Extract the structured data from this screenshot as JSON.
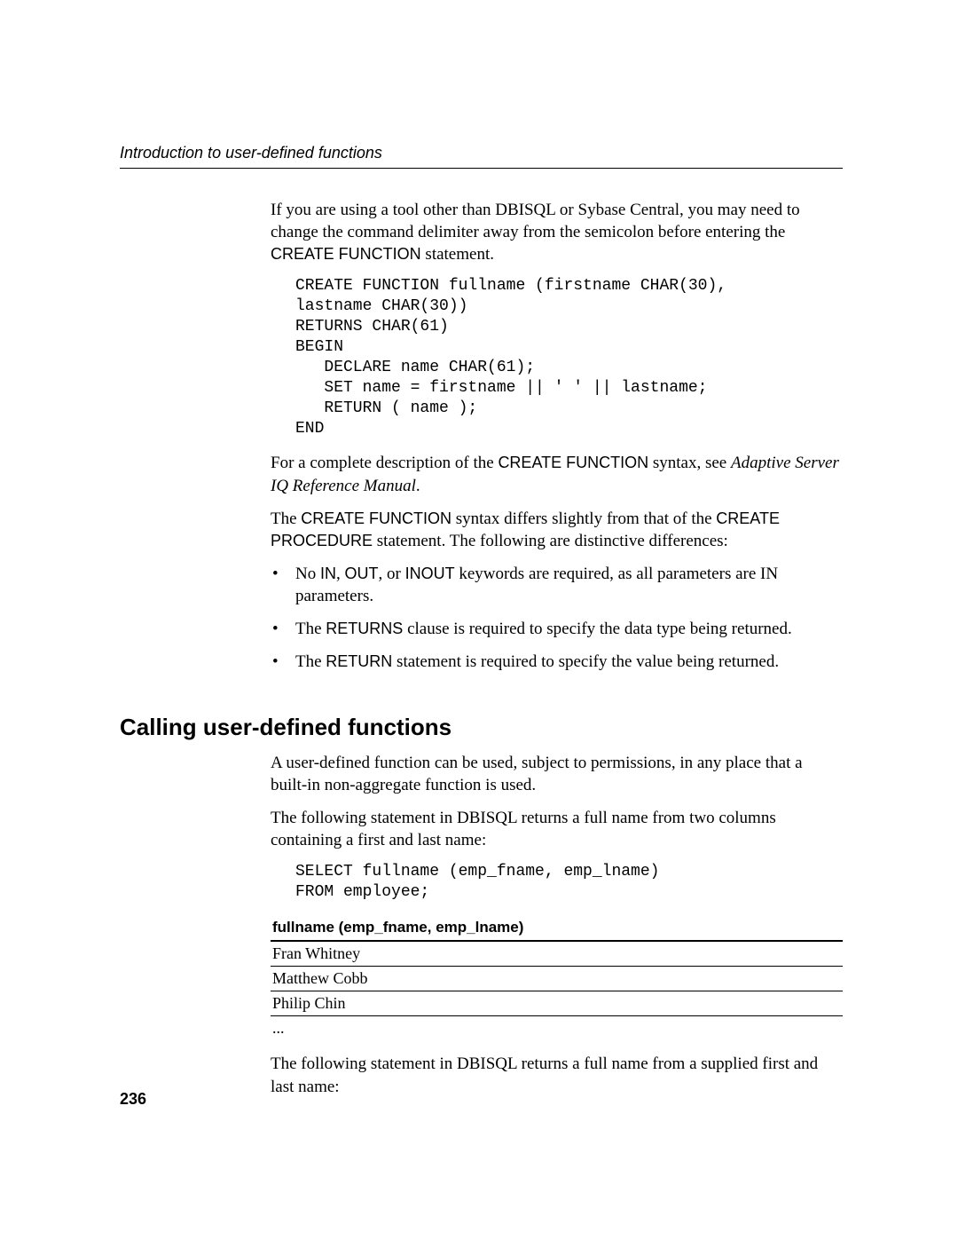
{
  "header": {
    "running": "Introduction to user-defined functions"
  },
  "intro": {
    "p1_a": "If you are using a tool other than DBISQL or Sybase Central, you may need to change the command delimiter away from the semicolon before entering the ",
    "p1_b": "CREATE FUNCTION",
    "p1_c": " statement."
  },
  "code1": "CREATE FUNCTION fullname (firstname CHAR(30),\nlastname CHAR(30))\nRETURNS CHAR(61)\nBEGIN\n   DECLARE name CHAR(61);\n   SET name = firstname || ' ' || lastname;\n   RETURN ( name );\nEND",
  "p2": {
    "a": "For a complete description of the ",
    "b": "CREATE FUNCTION",
    "c": " syntax, see ",
    "d": "Adaptive Server IQ Reference Manual",
    "e": "."
  },
  "p3": {
    "a": "The ",
    "b": "CREATE FUNCTION",
    "c": " syntax differs slightly from that of the ",
    "d": "CREATE PROCEDURE",
    "e": " statement. The following are distinctive differences:"
  },
  "bullets": {
    "b1a": "No ",
    "b1b": "IN",
    "b1c": ", ",
    "b1d": "OUT",
    "b1e": ", or ",
    "b1f": "INOUT",
    "b1g": " keywords are required, as all parameters are IN parameters.",
    "b2a": "The ",
    "b2b": "RETURNS",
    "b2c": " clause is required to specify the data type being returned.",
    "b3a": "The ",
    "b3b": "RETURN",
    "b3c": " statement is required to specify the value being returned."
  },
  "section2": {
    "title": "Calling user-defined functions",
    "p1": "A user-defined function can be used, subject to permissions, in any place that a built-in non-aggregate function is used.",
    "p2": "The following statement in DBISQL returns a full name from two columns containing a first and last name:"
  },
  "code2": "SELECT fullname (emp_fname, emp_lname)\nFROM employee;",
  "table": {
    "header": "fullname (emp_fname, emp_lname)",
    "rows": [
      "Fran Whitney",
      "Matthew Cobb",
      "Philip Chin"
    ],
    "more": "..."
  },
  "p_after_table": "The following statement in DBISQL returns a full name from a supplied first and last name:",
  "page_number": "236"
}
